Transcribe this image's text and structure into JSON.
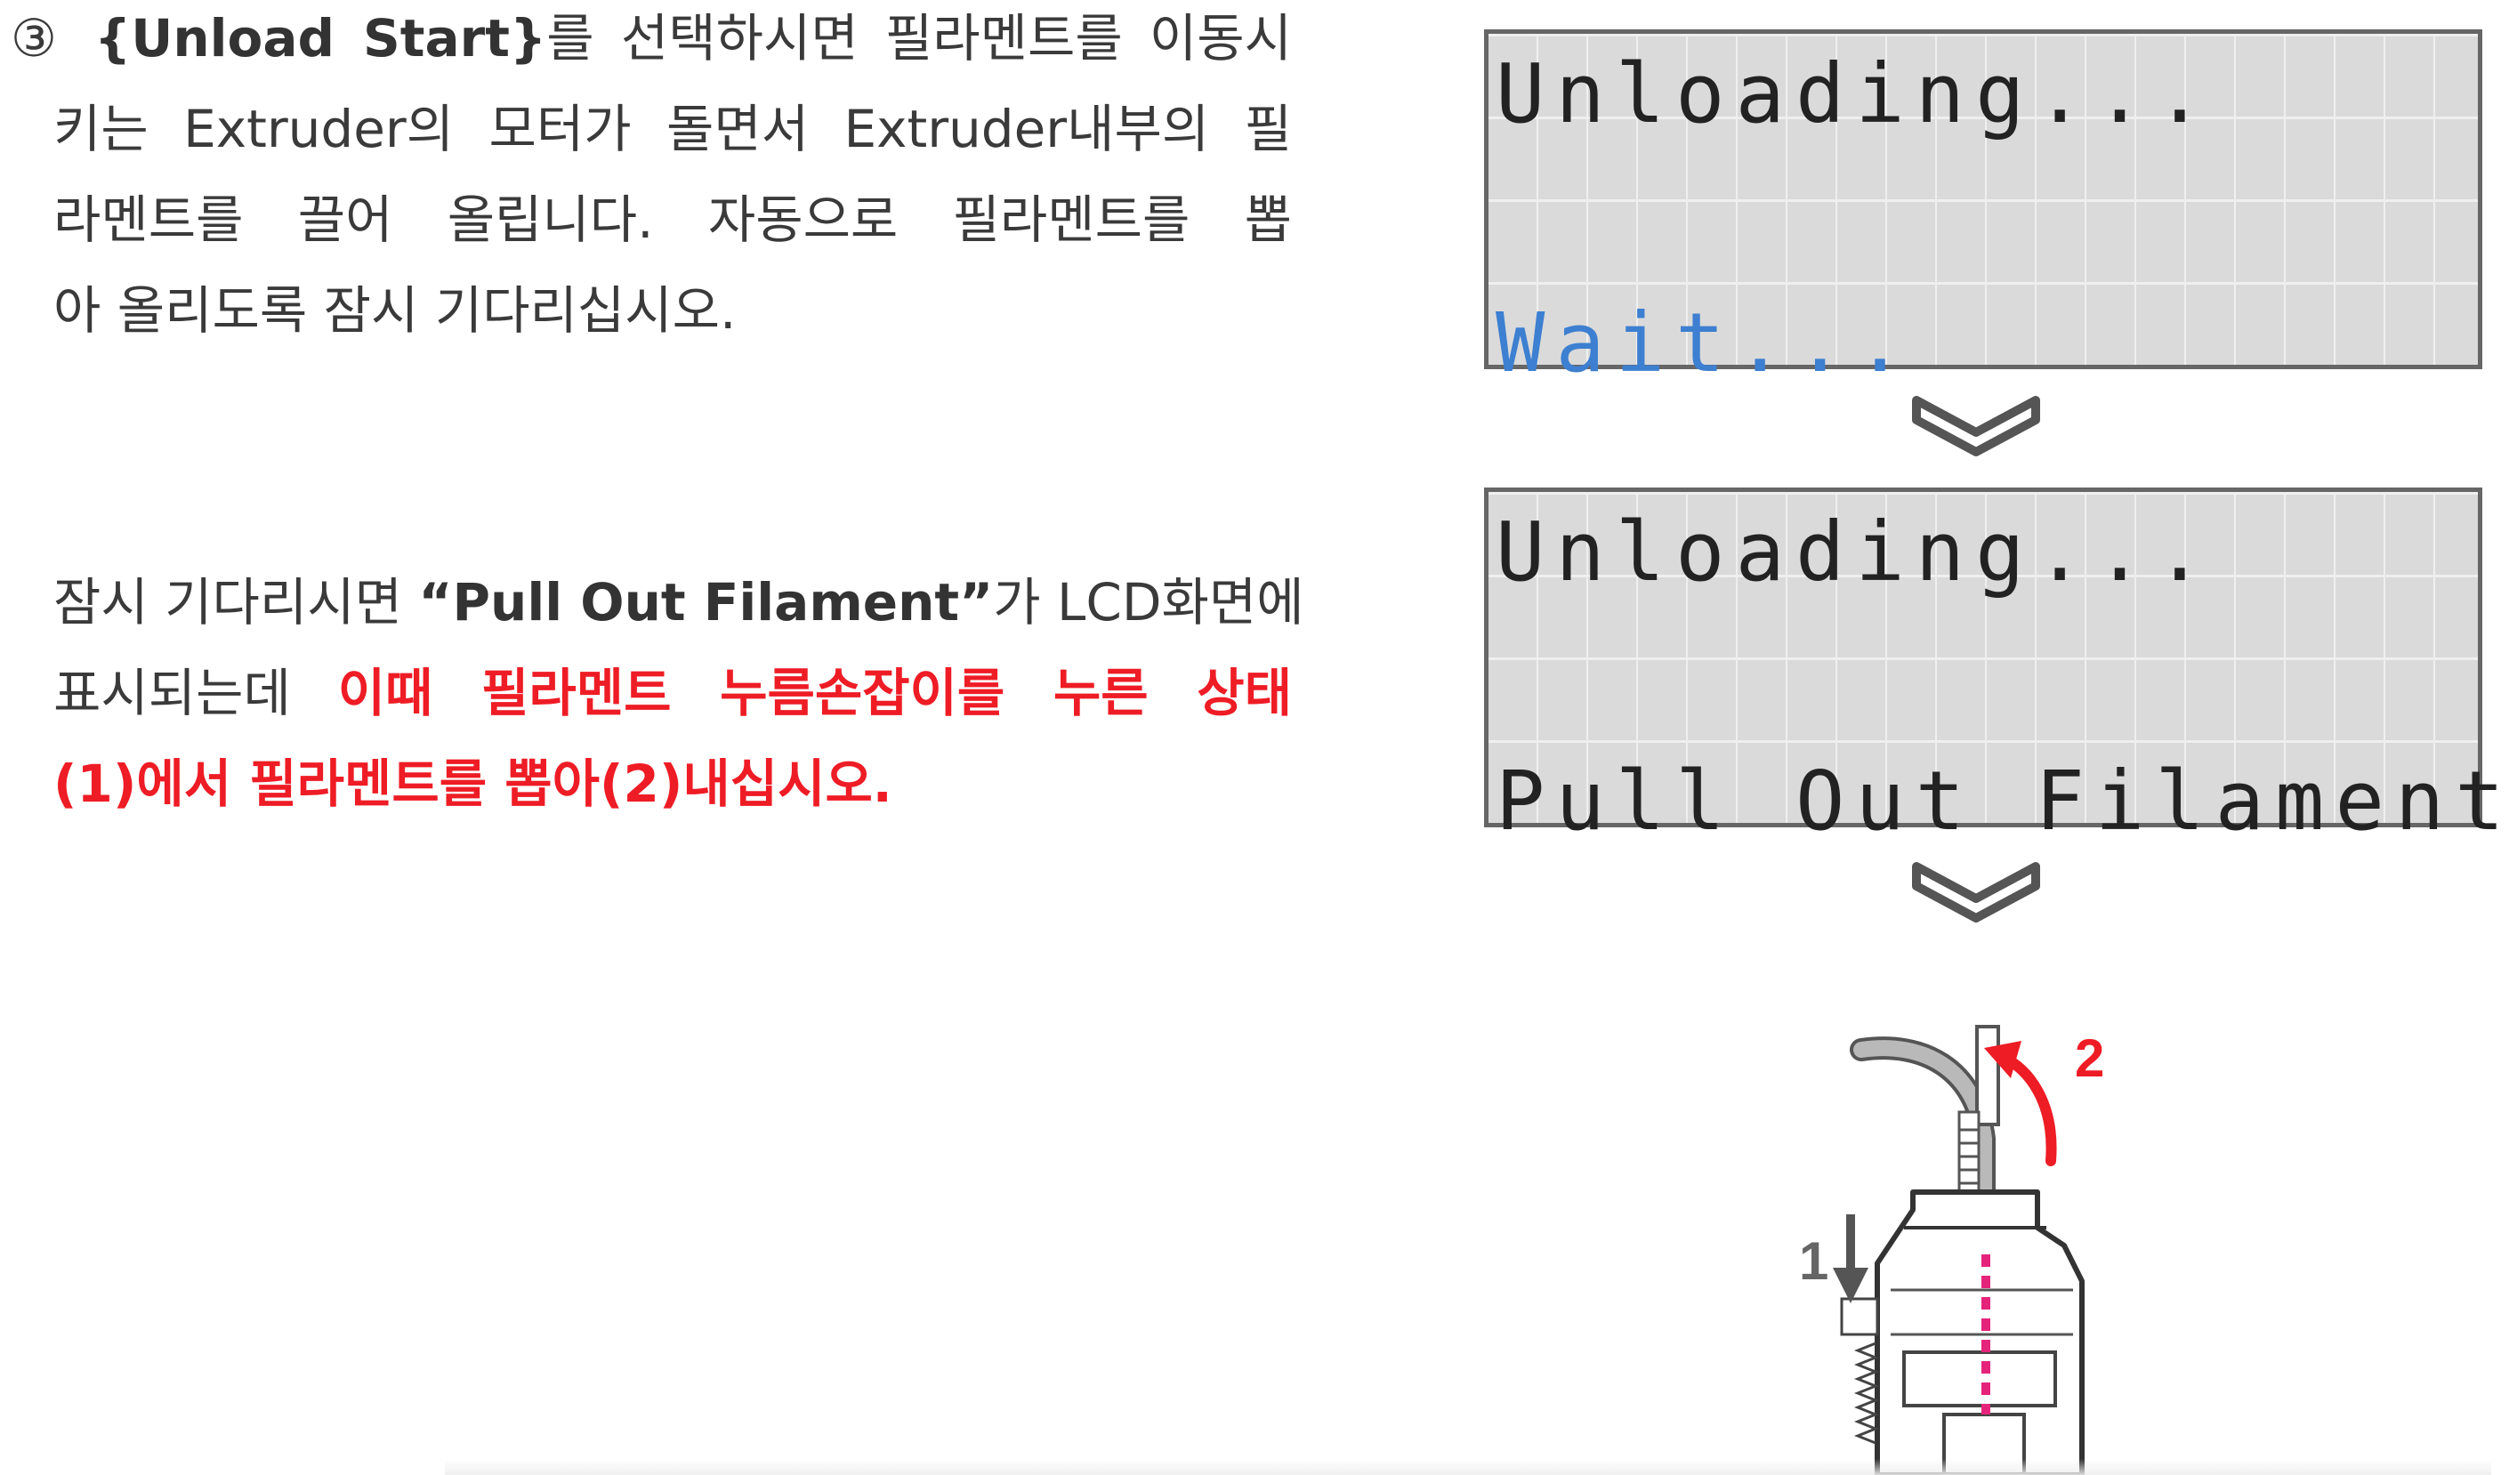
{
  "step1": {
    "marker": "③",
    "highlight": "{Unload Start}",
    "line1_rest": "를 선택하시면 필라멘트를 이동시",
    "line2": "키는 Extruder의 모터가 돌면서 Extruder내부의 필",
    "line3": "라멘트를 끌어 올립니다. 자동으로 필라멘트를 뽑",
    "line4": "아 올리도록 잠시 기다리십시오."
  },
  "step2": {
    "line1_prefix": "잠시 기다리시면 ",
    "line1_bold": "“Pull Out Filament”",
    "line1_suffix": "가 LCD화면에",
    "line2_prefix": "표시되는데 ",
    "line2_red": "이때 필라멘트 누름손잡이를 누른 상태",
    "line3_red": "(1)에서 필라멘트를 뽑아(2)내십시오."
  },
  "lcd_screens": [
    {
      "top_text": "Unloading...",
      "bottom_text": "Wait..."
    },
    {
      "top_text": "Unloading...",
      "bottom_text": "Pull Out Filament"
    }
  ],
  "illustration": {
    "label_press": "1",
    "label_pull": "2"
  },
  "colors": {
    "emphasis_red": "#ee1c25",
    "lcd_blue": "#3d7fd0",
    "lcd_background": "#dadada",
    "filament_path_pink": "#e5237a"
  }
}
